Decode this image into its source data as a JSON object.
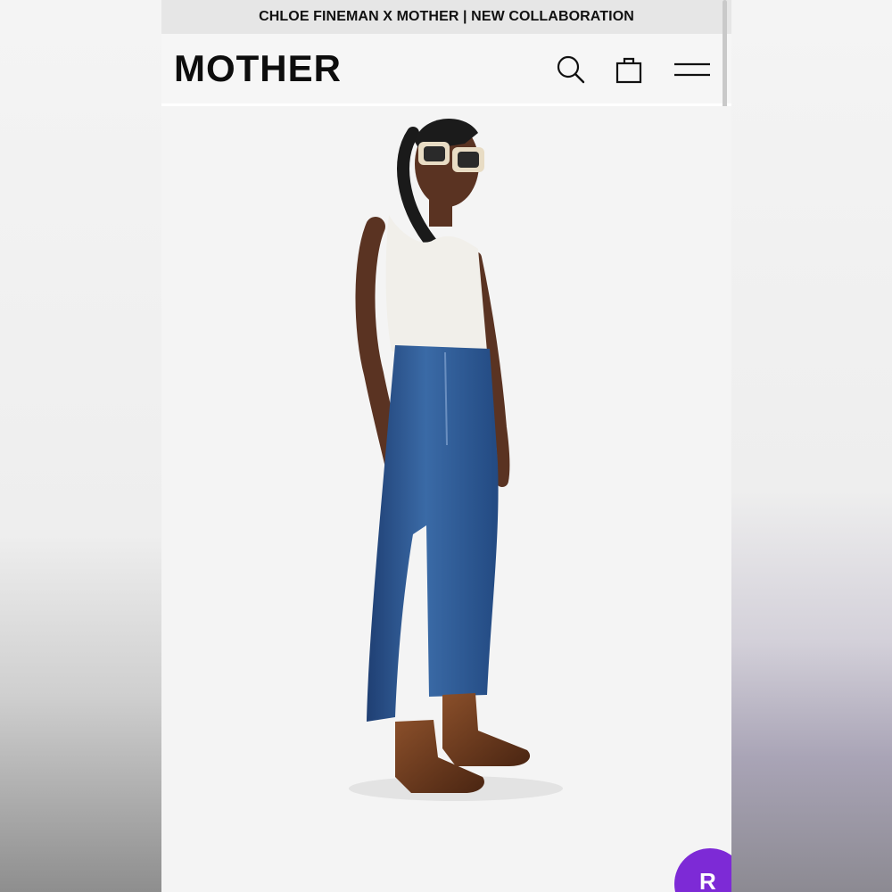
{
  "banner": {
    "text": "CHLOE FINEMAN X MOTHER | NEW COLLABORATION"
  },
  "header": {
    "logo": "MOTHER",
    "icons": [
      "search-icon",
      "shopping-bag-icon",
      "hamburger-menu-icon"
    ]
  },
  "product_image": {
    "subject": "model-in-bootcut-jeans"
  },
  "chat_button": {
    "label": "R",
    "color": "#7d2ad6"
  },
  "colors": {
    "banner_bg": "#e6e6e6",
    "page_bg": "#f4f4f4",
    "denim": "#2f5b95",
    "boots": "#6b3a1e"
  }
}
